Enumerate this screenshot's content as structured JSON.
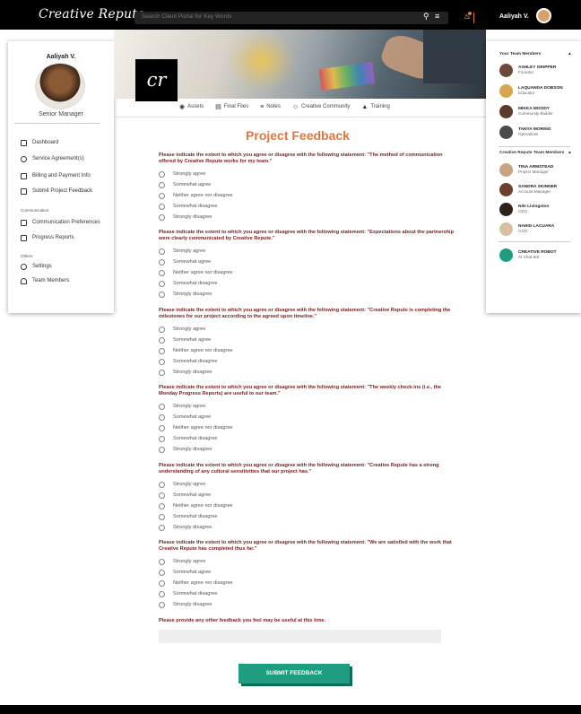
{
  "header": {
    "brand": "Creative Repute",
    "search_placeholder": "Search Client Portal for Key Words",
    "user_name": "Aaliyah V."
  },
  "sidebar": {
    "name": "Aaliyah V.",
    "role": "Senior Manager",
    "items": [
      {
        "label": "Dashboard",
        "icon": "dashboard-icon"
      },
      {
        "label": "Service Agreement(s)",
        "icon": "agreement-icon"
      },
      {
        "label": "Billing and Payment Info",
        "icon": "billing-icon"
      },
      {
        "label": "Submit Project Feedback",
        "icon": "feedback-icon"
      }
    ],
    "section_communication": "Communication",
    "comm_items": [
      {
        "label": "Communication Preferences",
        "icon": "preferences-icon"
      },
      {
        "label": "Progress Reports",
        "icon": "reports-icon"
      }
    ],
    "section_others": "Others",
    "other_items": [
      {
        "label": "Settings",
        "icon": "gear-icon"
      },
      {
        "label": "Team Members",
        "icon": "team-icon"
      }
    ]
  },
  "banner": {
    "logo": "cr"
  },
  "tabs": [
    {
      "label": "Assets"
    },
    {
      "label": "Final Files"
    },
    {
      "label": "Notes"
    },
    {
      "label": "Creative Community"
    },
    {
      "label": "Training"
    }
  ],
  "form": {
    "title": "Project Feedback",
    "options": [
      "Strongly agree",
      "Somewhat agree",
      "Neither agree nor disagree",
      "Somewhat disagree",
      "Strongly disagree"
    ],
    "questions": [
      "Please indicate the extent to which you agree or disagree with the following statement: \"The method of communication offered by Creative Repute works for my team.\"",
      "Please indicate the extent to which you agree or disagree with the following statement: \"Expectations about the partnership were clearly communicated by Creative Repute.\"",
      "Please indicate the extent to which you agree or disagree with the following statement: \"Creative Repute is completing the milestones for our project according to the agreed upon timeline.\"",
      "Please indicate the extent to which you agree or disagree with the following statement: \"The weekly check-ins (i.e., the Monday Progress Reports) are useful to our team.\"",
      "Please indicate the extent to which you agree or disagree with the following statement: \"Creative Repute has a strong understanding of any cultural sensitivities that our project has.\"",
      "Please indicate the extent to which you agree or disagree with the following statement: \"We are satisfied with the work that Creative Repute has completed thus far.\""
    ],
    "other_feedback_label": "Please provide any other feedback you feel may be useful at this time.",
    "submit_label": "SUBMIT FEEDBACK"
  },
  "right_panel": {
    "your_team_title": "Your Team Members",
    "your_team": [
      {
        "name": "ASHLEY GRIPPER",
        "role": "Founder",
        "color": "#6b4a3a"
      },
      {
        "name": "LAQUANDA DOBSON",
        "role": "Educator",
        "color": "#d8a64a"
      },
      {
        "name": "MIKKA MOODY",
        "role": "Community Builder",
        "color": "#5a3a2a"
      },
      {
        "name": "TANYA MORING",
        "role": "Operations",
        "color": "#4a4a4a"
      }
    ],
    "cr_team_title": "Creative Repute Team Members",
    "cr_team": [
      {
        "name": "TINA ARMSTEAD",
        "role": "Project Manager",
        "color": "#c7a37f"
      },
      {
        "name": "SANDRA SKINNER",
        "role": "Account Manager",
        "color": "#6e3f2b"
      },
      {
        "name": "Nile Livingston",
        "role": "CEO",
        "color": "#2e2219"
      },
      {
        "name": "NAHID LACUARA",
        "role": "COO",
        "color": "#d8bfa0"
      }
    ],
    "bot": {
      "name": "CREATIVE ROBOT",
      "role": "AI Chat Bot",
      "color": "#1f9d80"
    }
  }
}
